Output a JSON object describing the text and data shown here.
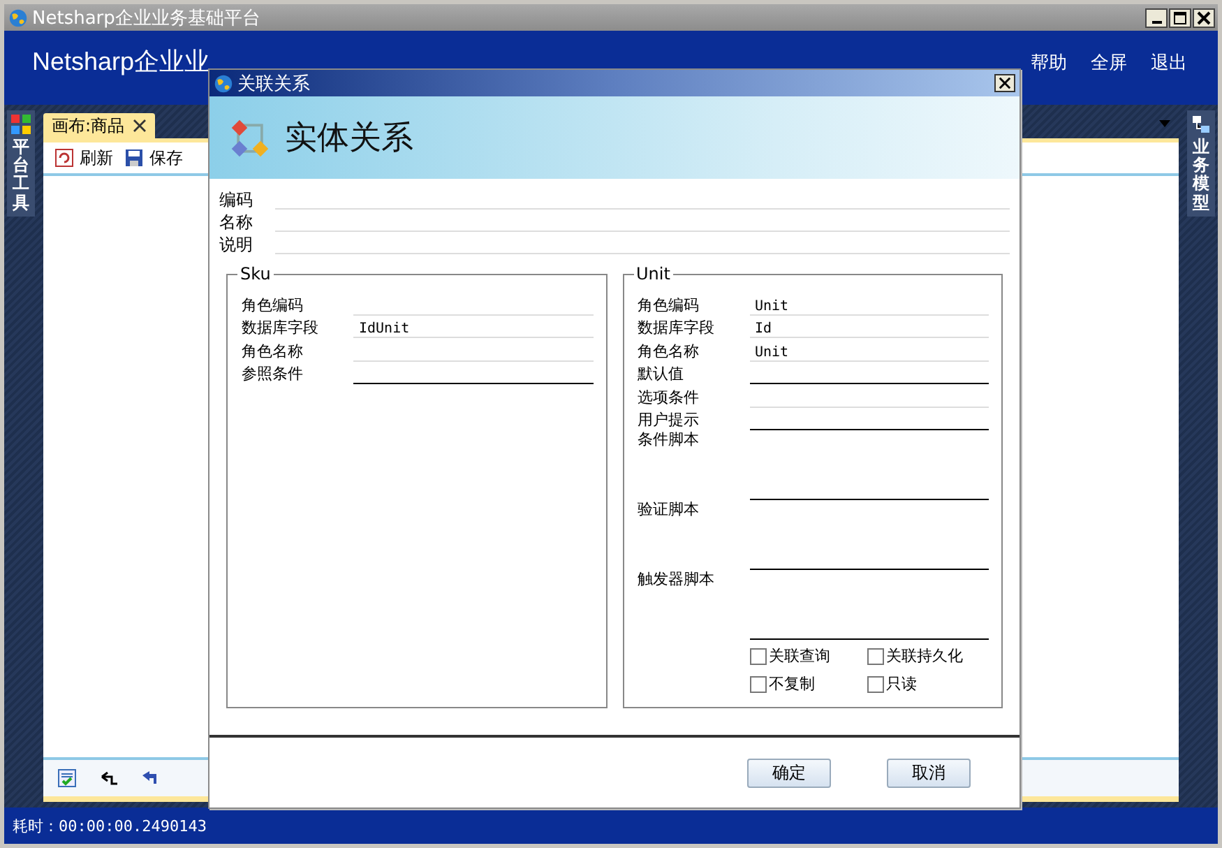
{
  "window": {
    "title": "Netsharp企业业务基础平台"
  },
  "header": {
    "title": "Netsharp企业业",
    "menu": [
      "帮助",
      "全屏",
      "退出"
    ]
  },
  "left_dock": {
    "label": "平台工具"
  },
  "right_dock": {
    "label": "业务模型"
  },
  "document_tab": {
    "label": "画布:商品",
    "selected": true
  },
  "toolbar": [
    {
      "label": "刷新",
      "kind": "refresh"
    },
    {
      "label": "保存",
      "kind": "save"
    }
  ],
  "dialog": {
    "title": "关联关系",
    "heading": "实体关系",
    "fields": [
      {
        "label": "编码"
      },
      {
        "label": "名称"
      },
      {
        "label": "说明"
      }
    ],
    "groups": [
      {
        "title": "Sku",
        "fields": [
          {
            "label": "角色编码",
            "kind": "line"
          },
          {
            "label": "数据库字段",
            "value": "IdUnit",
            "kind": "line"
          },
          {
            "label": "角色名称",
            "kind": "line"
          },
          {
            "label": "参照条件",
            "kind": "box"
          }
        ]
      },
      {
        "title": "Unit",
        "fields": [
          {
            "label": "角色编码",
            "value": "Unit",
            "kind": "line"
          },
          {
            "label": "数据库字段",
            "value": "Id",
            "kind": "line"
          },
          {
            "label": "角色名称",
            "value": "Unit",
            "kind": "line"
          },
          {
            "label": "默认值",
            "kind": "box"
          },
          {
            "label": "选项条件",
            "kind": "line"
          },
          {
            "label": "用户提示",
            "kind": "box"
          },
          {
            "label": "条件脚本",
            "kind": "script"
          },
          {
            "label": "验证脚本",
            "kind": "script"
          },
          {
            "label": "触发器脚本",
            "kind": "script"
          }
        ],
        "options": [
          {
            "label": "关联查询",
            "checked": false
          },
          {
            "label": "关联持久化",
            "checked": false
          },
          {
            "label": "不复制",
            "checked": false
          },
          {
            "label": "只读",
            "checked": false
          }
        ]
      }
    ],
    "buttons": [
      "确定",
      "取消"
    ]
  },
  "status_bar": {
    "text": "耗时：00:00:00.2490143"
  }
}
